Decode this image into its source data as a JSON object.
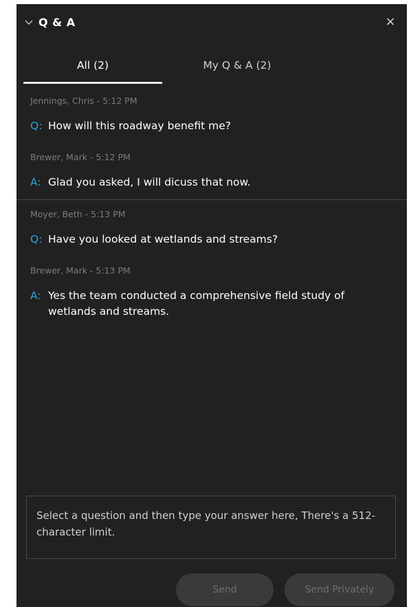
{
  "panel": {
    "title": "Q & A",
    "close_glyph": "×"
  },
  "tabs": [
    {
      "label": "All (2)",
      "selected": true
    },
    {
      "label": "My Q & A (2)",
      "selected": false
    }
  ],
  "threads": [
    {
      "question": {
        "author": "Jennings, Chris - 5:12 PM",
        "prefix": "Q:",
        "text": "How will this roadway benefit me?"
      },
      "answer": {
        "author": "Brewer, Mark - 5:12 PM",
        "prefix": "A:",
        "text": "Glad you asked, I will dicuss that now."
      }
    },
    {
      "question": {
        "author": "Moyer, Beth - 5:13 PM",
        "prefix": "Q:",
        "text": "Have you looked at wetlands and streams?"
      },
      "answer": {
        "author": "Brewer, Mark - 5:13 PM",
        "prefix": "A:",
        "text": "Yes the team conducted a comprehensive field study of wetlands and streams."
      }
    }
  ],
  "answer_input": {
    "placeholder": "Select a question and then type your answer here, There's a 512-character limit.",
    "value": ""
  },
  "buttons": {
    "send": "Send",
    "send_privately": "Send Privately"
  },
  "colors": {
    "panel_bg": "#212121",
    "accent": "#2aa0d8",
    "meta_text": "#7c7c7c",
    "button_bg": "#3a3a3a"
  },
  "icons": {
    "collapse": "chevron-down-icon",
    "close": "close-icon"
  }
}
